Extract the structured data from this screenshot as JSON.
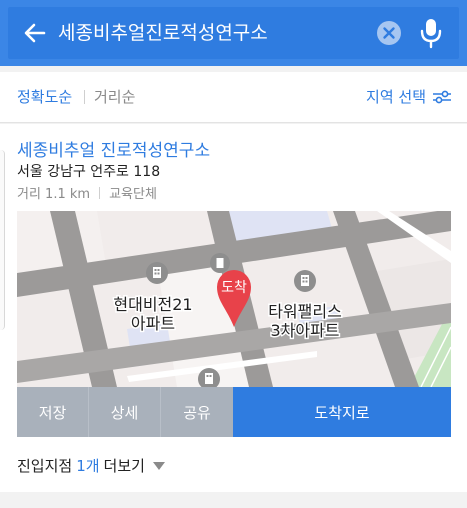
{
  "search": {
    "query": "세종비추얼진로적성연구소"
  },
  "sort": {
    "accuracy": "정확도순",
    "distance": "거리순",
    "region": "지역 선택"
  },
  "result": {
    "title": "세종비추얼 진로적성연구소",
    "address": "서울 강남구 언주로 118",
    "distance": "거리 1.1 km",
    "category": "교육단체"
  },
  "map": {
    "marker_label": "도착",
    "building_1": [
      "현대비전21",
      "아파트"
    ],
    "building_2": [
      "타워팰리스",
      "3차아파트"
    ]
  },
  "actions": {
    "save": "저장",
    "detail": "상세",
    "share": "공유",
    "directions": "도착지로"
  },
  "entry": {
    "label": "진입지점",
    "count": "1개",
    "more": "더보기"
  },
  "colors": {
    "accent": "#2f7ce0",
    "marker": "#e8424a",
    "action_gray": "#a9b1bb"
  }
}
